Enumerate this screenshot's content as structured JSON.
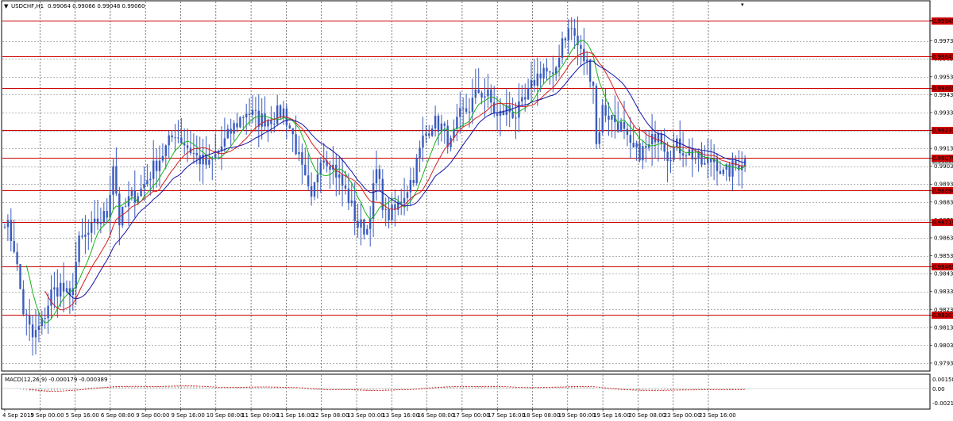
{
  "header": {
    "arrow": "▼",
    "symbol": "USDCHF,H1",
    "ohlc": "0.99064 0.99066 0.99048 0.99060"
  },
  "macd_header": {
    "label": "MACD(12,26,9) -0.000179 -0.000389"
  },
  "colors": {
    "candle": "#3a5bbf",
    "ma_fast": "#18b31a",
    "ma_mid": "#d42020",
    "ma_slow": "#1414a6",
    "level_line": "#cc0000",
    "level_tag_bg": "#cc0000",
    "grid": "#9a9a9a",
    "macd_signal": "#cc0000",
    "macd_hist": "#aaaaaa"
  },
  "chart_data": {
    "type": "candlestick",
    "symbol": "USDCHF",
    "timeframe": "H1",
    "ylim": [
      0.9789,
      0.9995
    ],
    "y_ticks": [
      "0.99845",
      "0.99730",
      "0.99630",
      "0.99530",
      "0.99430",
      "0.99330",
      "0.99230",
      "0.99130",
      "0.99030",
      "0.98930",
      "0.98830",
      "0.98730",
      "0.98630",
      "0.98530",
      "0.98430",
      "0.98330",
      "0.98230",
      "0.98130",
      "0.98030",
      "0.97930"
    ],
    "x_ticks": [
      "4 Sep 2019",
      "5 Sep 00:00",
      "5 Sep 16:00",
      "6 Sep 08:00",
      "9 Sep 00:00",
      "9 Sep 16:00",
      "10 Sep 08:00",
      "11 Sep 00:00",
      "11 Sep 16:00",
      "12 Sep 08:00",
      "13 Sep 00:00",
      "13 Sep 16:00",
      "16 Sep 08:00",
      "17 Sep 00:00",
      "17 Sep 16:00",
      "18 Sep 08:00",
      "19 Sep 00:00",
      "19 Sep 16:00",
      "20 Sep 08:00",
      "23 Sep 00:00",
      "23 Sep 16:00"
    ],
    "levels": [
      "0.99845",
      "0.99643",
      "0.99465",
      "0.99233",
      "0.99079",
      "0.98894",
      "0.98719",
      "0.98469",
      "0.98201"
    ],
    "current_price": "0.99060",
    "anchors": [
      [
        0,
        0.9874
      ],
      [
        3,
        0.9858
      ],
      [
        6,
        0.9822
      ],
      [
        9,
        0.9807
      ],
      [
        12,
        0.9815
      ],
      [
        15,
        0.9832
      ],
      [
        18,
        0.9836
      ],
      [
        21,
        0.9828
      ],
      [
        24,
        0.986
      ],
      [
        27,
        0.9865
      ],
      [
        30,
        0.9872
      ],
      [
        33,
        0.9876
      ],
      [
        35,
        0.9905
      ],
      [
        37,
        0.9872
      ],
      [
        40,
        0.9884
      ],
      [
        44,
        0.989
      ],
      [
        48,
        0.9902
      ],
      [
        52,
        0.9913
      ],
      [
        55,
        0.9922
      ],
      [
        58,
        0.9916
      ],
      [
        62,
        0.9908
      ],
      [
        66,
        0.9903
      ],
      [
        70,
        0.9914
      ],
      [
        74,
        0.9925
      ],
      [
        78,
        0.9934
      ],
      [
        82,
        0.9929
      ],
      [
        86,
        0.993
      ],
      [
        90,
        0.9934
      ],
      [
        93,
        0.992
      ],
      [
        96,
        0.99
      ],
      [
        99,
        0.9882
      ],
      [
        102,
        0.991
      ],
      [
        105,
        0.9906
      ],
      [
        108,
        0.9896
      ],
      [
        111,
        0.9885
      ],
      [
        114,
        0.987
      ],
      [
        117,
        0.9868
      ],
      [
        120,
        0.99
      ],
      [
        123,
        0.9875
      ],
      [
        126,
        0.9878
      ],
      [
        129,
        0.9888
      ],
      [
        132,
        0.9898
      ],
      [
        135,
        0.9918
      ],
      [
        138,
        0.9928
      ],
      [
        141,
        0.9925
      ],
      [
        144,
        0.9915
      ],
      [
        147,
        0.9931
      ],
      [
        150,
        0.9936
      ],
      [
        153,
        0.9945
      ],
      [
        156,
        0.9942
      ],
      [
        159,
        0.993
      ],
      [
        162,
        0.9935
      ],
      [
        165,
        0.9932
      ],
      [
        168,
        0.9939
      ],
      [
        171,
        0.9951
      ],
      [
        174,
        0.9958
      ],
      [
        177,
        0.995
      ],
      [
        180,
        0.9975
      ],
      [
        183,
        0.998
      ],
      [
        186,
        0.9966
      ],
      [
        188,
        0.996
      ],
      [
        190,
        0.995
      ],
      [
        191,
        0.9915
      ],
      [
        193,
        0.9935
      ],
      [
        196,
        0.993
      ],
      [
        199,
        0.9925
      ],
      [
        202,
        0.9912
      ],
      [
        205,
        0.9911
      ],
      [
        208,
        0.9913
      ],
      [
        211,
        0.9925
      ],
      [
        214,
        0.991
      ],
      [
        217,
        0.9914
      ],
      [
        220,
        0.9912
      ],
      [
        223,
        0.9908
      ],
      [
        226,
        0.9903
      ],
      [
        229,
        0.9908
      ],
      [
        232,
        0.9898
      ],
      [
        235,
        0.9902
      ],
      [
        238,
        0.9906
      ],
      [
        240,
        0.9906
      ]
    ],
    "n_bars": 240
  }
}
